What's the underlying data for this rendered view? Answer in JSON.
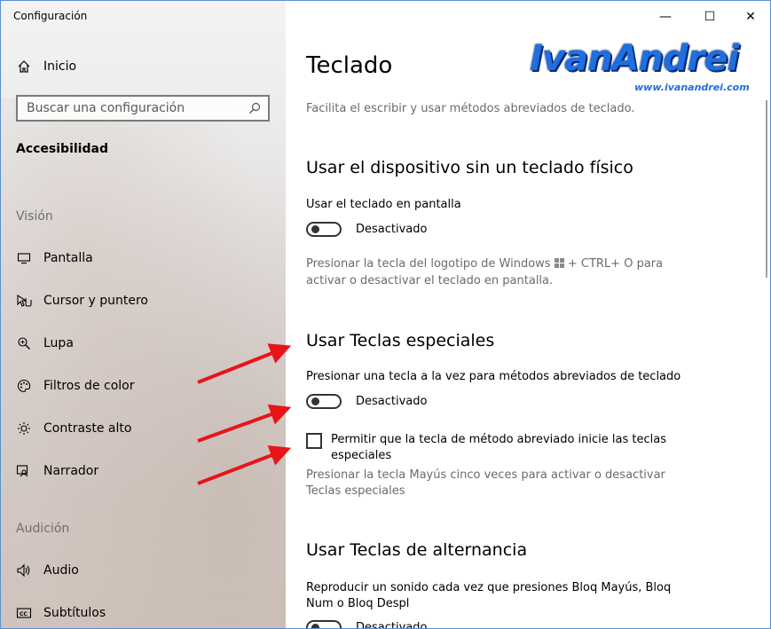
{
  "window": {
    "title": "Configuración",
    "controls": [
      "—",
      "☐",
      "✕"
    ]
  },
  "sidebar": {
    "home_label": "Inicio",
    "search_placeholder": "Buscar una configuración",
    "section_title": "Accesibilidad",
    "groups": [
      {
        "label": "Visión",
        "items": [
          {
            "label": "Pantalla",
            "icon": "monitor-icon"
          },
          {
            "label": "Cursor y puntero",
            "icon": "pointer-icon"
          },
          {
            "label": "Lupa",
            "icon": "magnifier-icon"
          },
          {
            "label": "Filtros de color",
            "icon": "palette-icon"
          },
          {
            "label": "Contraste alto",
            "icon": "sun-icon"
          },
          {
            "label": "Narrador",
            "icon": "narrator-icon"
          }
        ]
      },
      {
        "label": "Audición",
        "items": [
          {
            "label": "Audio",
            "icon": "speaker-icon"
          },
          {
            "label": "Subtítulos",
            "icon": "captions-icon"
          }
        ]
      }
    ]
  },
  "main": {
    "title": "Teclado",
    "subtitle": "Facilita el escribir y usar métodos abreviados de teclado.",
    "sections": [
      {
        "heading": "Usar el dispositivo sin un teclado físico",
        "setting_label": "Usar el teclado en pantalla",
        "toggle_state": "Desactivado",
        "description_before": "Presionar la tecla del logotipo de Windows",
        "description_after": "+ CTRL+ O para activar o desactivar el teclado en pantalla."
      },
      {
        "heading": "Usar Teclas especiales",
        "setting_label": "Presionar una tecla a la vez para métodos abreviados de teclado",
        "toggle_state": "Desactivado",
        "checkbox_label": "Permitir que la tecla de método abreviado inicie las teclas especiales",
        "description": "Presionar la tecla Mayús cinco veces para activar o desactivar Teclas especiales"
      },
      {
        "heading": "Usar Teclas de alternancia",
        "setting_label": "Reproducir un sonido cada vez que presiones Bloq Mayús, Bloq Num o Bloq Despl",
        "toggle_state": "Desactivado"
      }
    ]
  },
  "watermark": {
    "brand": "IvanAndrei",
    "url": "www.ivanandrei.com"
  },
  "colors": {
    "annotation_arrow": "#e8141a",
    "logo_blue": "#1e6fe0",
    "window_border": "#5a8fd4"
  }
}
